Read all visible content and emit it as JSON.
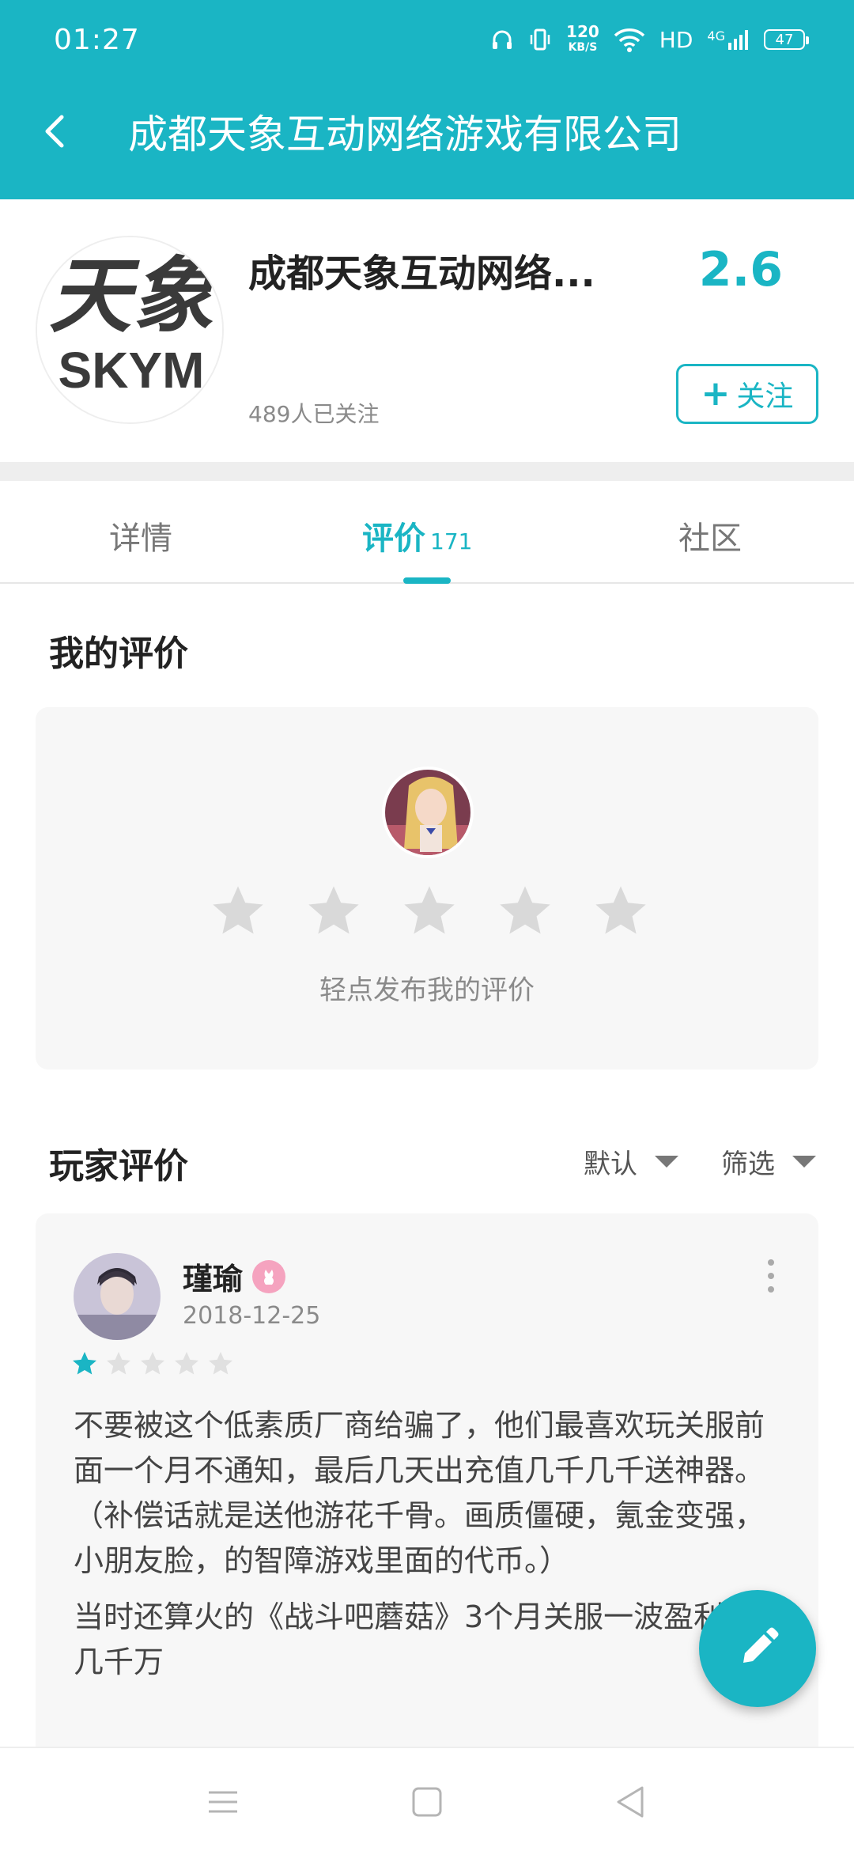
{
  "status_bar": {
    "time": "01:27",
    "net_speed_value": "120",
    "net_speed_unit": "KB/S",
    "hd": "HD",
    "network": "4G",
    "battery": "47"
  },
  "header": {
    "title": "成都天象互动网络游戏有限公司"
  },
  "company": {
    "name": "成都天象互动网络...",
    "score": "2.6",
    "followers": "489人已关注",
    "follow_label": "关注",
    "logo_text_top": "天象",
    "logo_text_bottom": "SKYM"
  },
  "tabs": {
    "details": "详情",
    "reviews": "评价",
    "reviews_count": "171",
    "community": "社区"
  },
  "my_review": {
    "title": "我的评价",
    "hint": "轻点发布我的评价",
    "rating": 0
  },
  "player_reviews": {
    "title": "玩家评价",
    "sort_label": "默认",
    "filter_label": "筛选",
    "items": [
      {
        "user": "瑾瑜",
        "date": "2018-12-25",
        "rating": 1,
        "text_1": "不要被这个低素质厂商给骗了，他们最喜欢玩关服前面一个月不通知，最后几天出充值几千几千送神器。（补偿话就是送他游花千骨。画质僵硬，氪金变强，小朋友脸，的智障游戏里面的代币。）",
        "text_2": "当时还算火的《战斗吧蘑菇》3个月关服一波盈利最少几千万"
      }
    ]
  },
  "colors": {
    "accent": "#1ab5c4",
    "star_empty": "#d9d9d9",
    "star_small_empty": "#e0e0e0"
  }
}
